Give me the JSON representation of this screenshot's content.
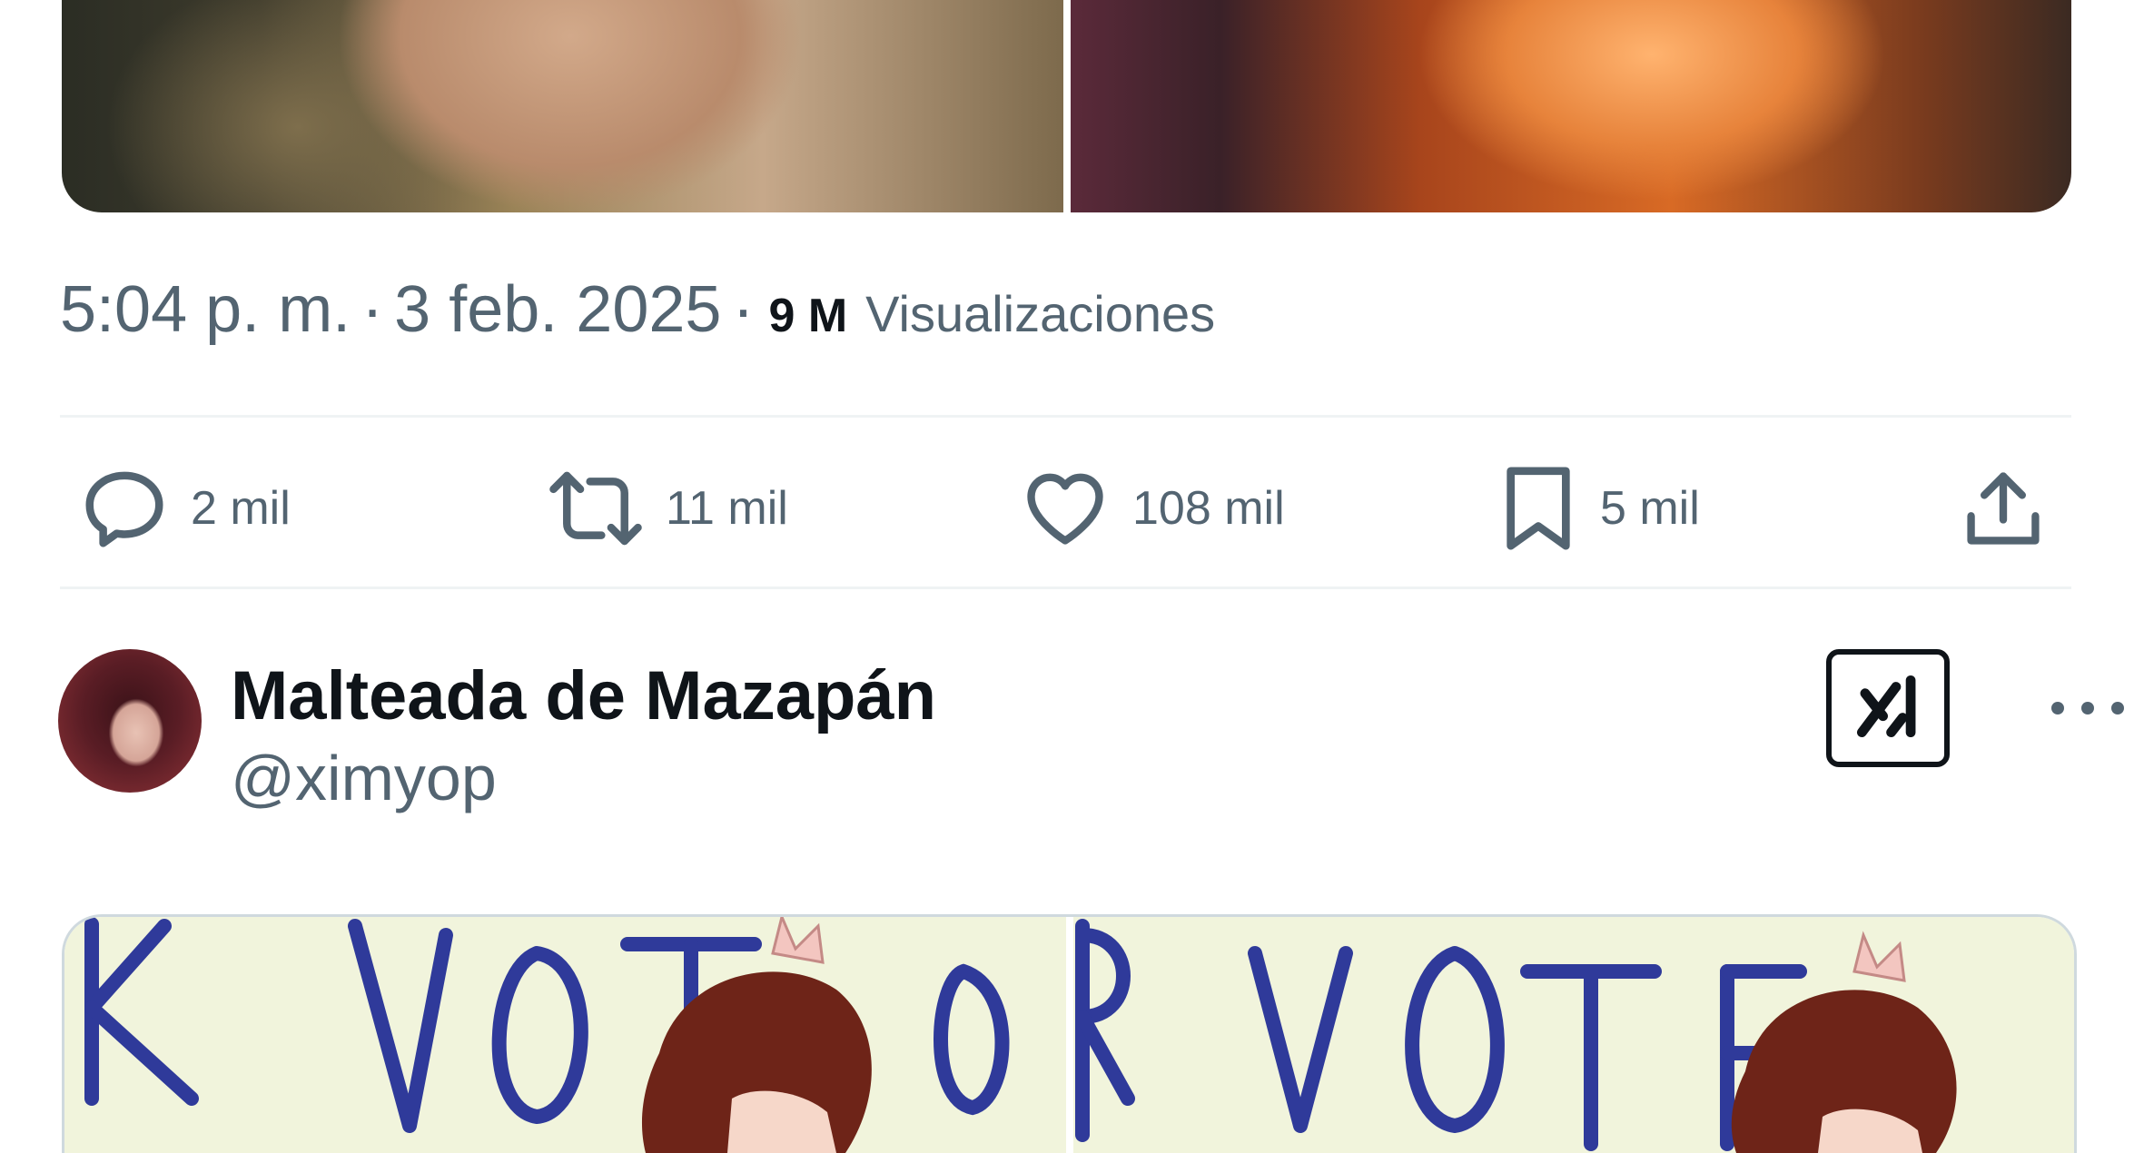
{
  "tweet": {
    "media_top": [
      {
        "alt": "photo-left"
      },
      {
        "alt": "photo-right"
      }
    ],
    "time": "5:04 p. m.",
    "separator": "·",
    "date": "3 feb. 2025",
    "separator2": "·",
    "views_count": "9 M",
    "views_label": "Visualizaciones",
    "actions": {
      "reply": {
        "icon": "reply-icon",
        "count": "2 mil"
      },
      "repost": {
        "icon": "repost-icon",
        "count": "11 mil"
      },
      "like": {
        "icon": "heart-icon",
        "count": "108 mil"
      },
      "bookmark": {
        "icon": "bookmark-icon",
        "count": "5 mil"
      },
      "share": {
        "icon": "share-icon"
      }
    }
  },
  "reply_post": {
    "display_name": "Malteada de Mazapán",
    "handle": "@ximyop",
    "grok_icon": "grok-icon",
    "more_icon": "more-icon",
    "media": [
      {
        "alt": "drawing-left"
      },
      {
        "alt": "drawing-right"
      }
    ]
  },
  "colors": {
    "text_primary": "#0f1419",
    "text_secondary": "#536471",
    "divider": "#eff3f4",
    "drawing_ink": "#2f3a9a"
  }
}
